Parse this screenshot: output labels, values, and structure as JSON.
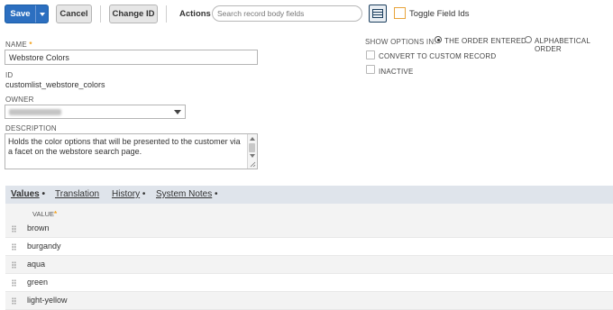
{
  "toolbar": {
    "save_label": "Save",
    "cancel_label": "Cancel",
    "change_id_label": "Change ID",
    "actions_label": "Actions",
    "search_placeholder": "Search record body fields",
    "toggle_field_ids_label": "Toggle Field Ids"
  },
  "form": {
    "name_label": "NAME",
    "name_value": "Webstore Colors",
    "id_label": "ID",
    "id_value": "customlist_webstore_colors",
    "owner_label": "OWNER",
    "description_label": "DESCRIPTION",
    "description_value": "Holds the color options that will be presented to the customer via a facet on the webstore search page.",
    "show_options_label": "SHOW OPTIONS IN:",
    "option_order_entered": "THE ORDER ENTERED",
    "option_alphabetical": "ALPHABETICAL ORDER",
    "selected_option": "THE ORDER ENTERED",
    "convert_label": "CONVERT TO CUSTOM RECORD",
    "inactive_label": "INACTIVE"
  },
  "tabs": [
    {
      "label": "Values",
      "active": true,
      "bullet": "•"
    },
    {
      "label": "Translation",
      "active": false,
      "bullet": ""
    },
    {
      "label": "History",
      "active": false,
      "bullet": "•"
    },
    {
      "label": "System Notes",
      "active": false,
      "bullet": "•"
    }
  ],
  "values_table": {
    "column_header": "VALUE",
    "rows": [
      "brown",
      "burgandy",
      "aqua",
      "green",
      "light-yellow"
    ]
  },
  "colors": {
    "primary_button": "#2c6fc0",
    "required_star": "#f3a11c",
    "tab_bar": "#dfe4eb"
  }
}
